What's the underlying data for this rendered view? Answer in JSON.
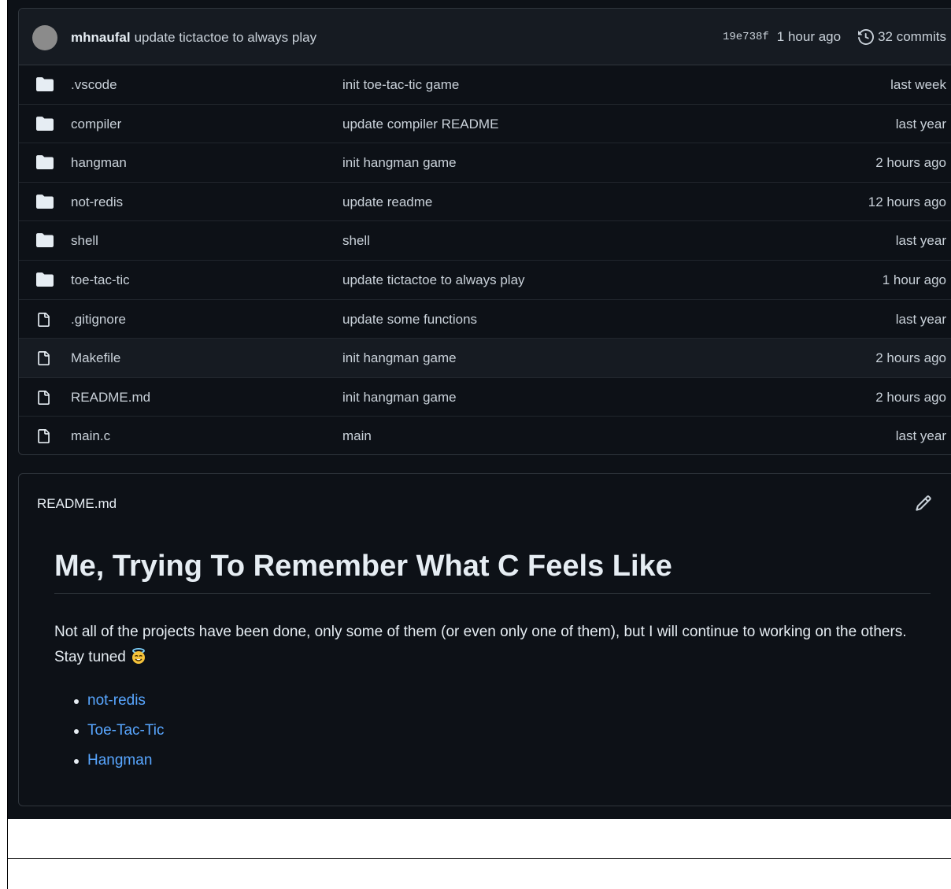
{
  "commit_bar": {
    "author": "mhnaufal",
    "message": "update tictactoe to always play",
    "sha": "19e738f",
    "time": "1 hour ago",
    "commits": "32 commits"
  },
  "files": [
    {
      "type": "folder",
      "name": ".vscode",
      "commit": "init toe-tac-tic game",
      "age": "last week"
    },
    {
      "type": "folder",
      "name": "compiler",
      "commit": "update compiler README",
      "age": "last year"
    },
    {
      "type": "folder",
      "name": "hangman",
      "commit": "init hangman game",
      "age": "2 hours ago"
    },
    {
      "type": "folder",
      "name": "not-redis",
      "commit": "update readme",
      "age": "12 hours ago"
    },
    {
      "type": "folder",
      "name": "shell",
      "commit": "shell",
      "age": "last year"
    },
    {
      "type": "folder",
      "name": "toe-tac-tic",
      "commit": "update tictactoe to always play",
      "age": "1 hour ago"
    },
    {
      "type": "file",
      "name": ".gitignore",
      "commit": "update some functions",
      "age": "last year"
    },
    {
      "type": "file",
      "name": "Makefile",
      "commit": "init hangman game",
      "age": "2 hours ago"
    },
    {
      "type": "file",
      "name": "README.md",
      "commit": "init hangman game",
      "age": "2 hours ago"
    },
    {
      "type": "file",
      "name": "main.c",
      "commit": "main",
      "age": "last year"
    }
  ],
  "readme": {
    "filename": "README.md",
    "title": "Me, Trying To Remember What C Feels Like",
    "paragraph": "Not all of the projects have been done, only some of them (or even only one of them), but I will continue to working on the others. Stay tuned",
    "links": [
      "not-redis",
      "Toe-Tac-Tic",
      "Hangman"
    ]
  },
  "colors": {
    "background": "#0d1117",
    "header": "#161b22",
    "border": "#30363d",
    "link": "#58a6ff",
    "text": "#c9d1d9"
  },
  "icons": {
    "folder": "folder-icon",
    "file": "file-icon",
    "history": "history-icon",
    "edit": "pencil-icon",
    "emoji": "smiling-face-with-halo-emoji"
  }
}
